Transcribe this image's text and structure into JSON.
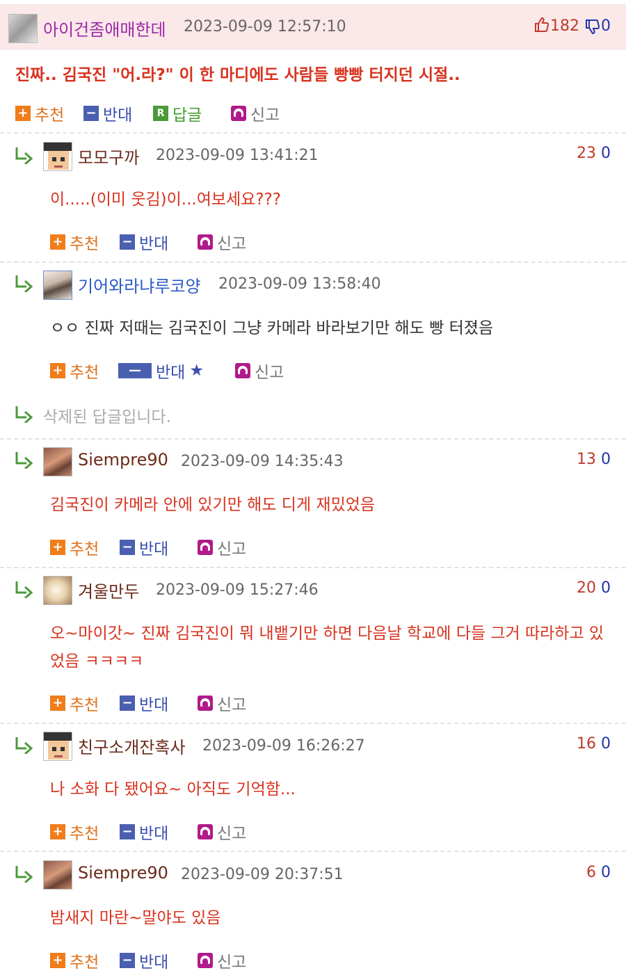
{
  "post": {
    "author": "아이건좀애매한데",
    "date": "2023-09-09 12:57:10",
    "up": "182",
    "down": "0",
    "title": "진짜.. 김국진 \"어.라?\" 이 한 마디에도 사람들 빵빵 터지던 시절..",
    "actions": {
      "recommend": "추천",
      "oppose": "반대",
      "reply_badge": "R",
      "reply": "답글",
      "report": "신고"
    }
  },
  "labels": {
    "recommend": "추천",
    "oppose": "반대",
    "report": "신고",
    "star": "★"
  },
  "colors": {
    "header_bg": "#fbe8e8",
    "red_text": "#d8321e",
    "nick_purple": "#9b2aa8",
    "nick_blue": "#2a5ac8",
    "nick_brown": "#6b2a1a"
  },
  "comments": [
    {
      "author": "모모구까",
      "date": "2023-09-09 13:41:21",
      "up": "23",
      "down": "0",
      "text": "이.....(이미 웃김)이...여보세요???"
    },
    {
      "author": "기어와라냐루코양",
      "date": "2023-09-09 13:58:40",
      "text": "ㅇㅇ 진짜 저때는 김국진이 그냥 카메라 바라보기만 해도 빵 터졌음"
    },
    {
      "deleted_text": "삭제된 답글입니다."
    },
    {
      "author": "Siempre90",
      "date": "2023-09-09 14:35:43",
      "up": "13",
      "down": "0",
      "text": "김국진이 카메라 안에 있기만 해도 디게 재밌었음"
    },
    {
      "author": "겨울만두",
      "date": "2023-09-09 15:27:46",
      "up": "20",
      "down": "0",
      "text": "오~마이갓~ 진짜 김국진이 뭐 내뱉기만 하면 다음날 학교에 다들 그거 따라하고 있었음 ㅋㅋㅋㅋ"
    },
    {
      "author": "친구소개잔혹사",
      "date": "2023-09-09 16:26:27",
      "up": "16",
      "down": "0",
      "text": "나 소화 다 됐어요~ 아직도 기억함..."
    },
    {
      "author": "Siempre90",
      "date": "2023-09-09 20:37:51",
      "up": "6",
      "down": "0",
      "text": "밤새지 마란~말야도 있음"
    }
  ]
}
